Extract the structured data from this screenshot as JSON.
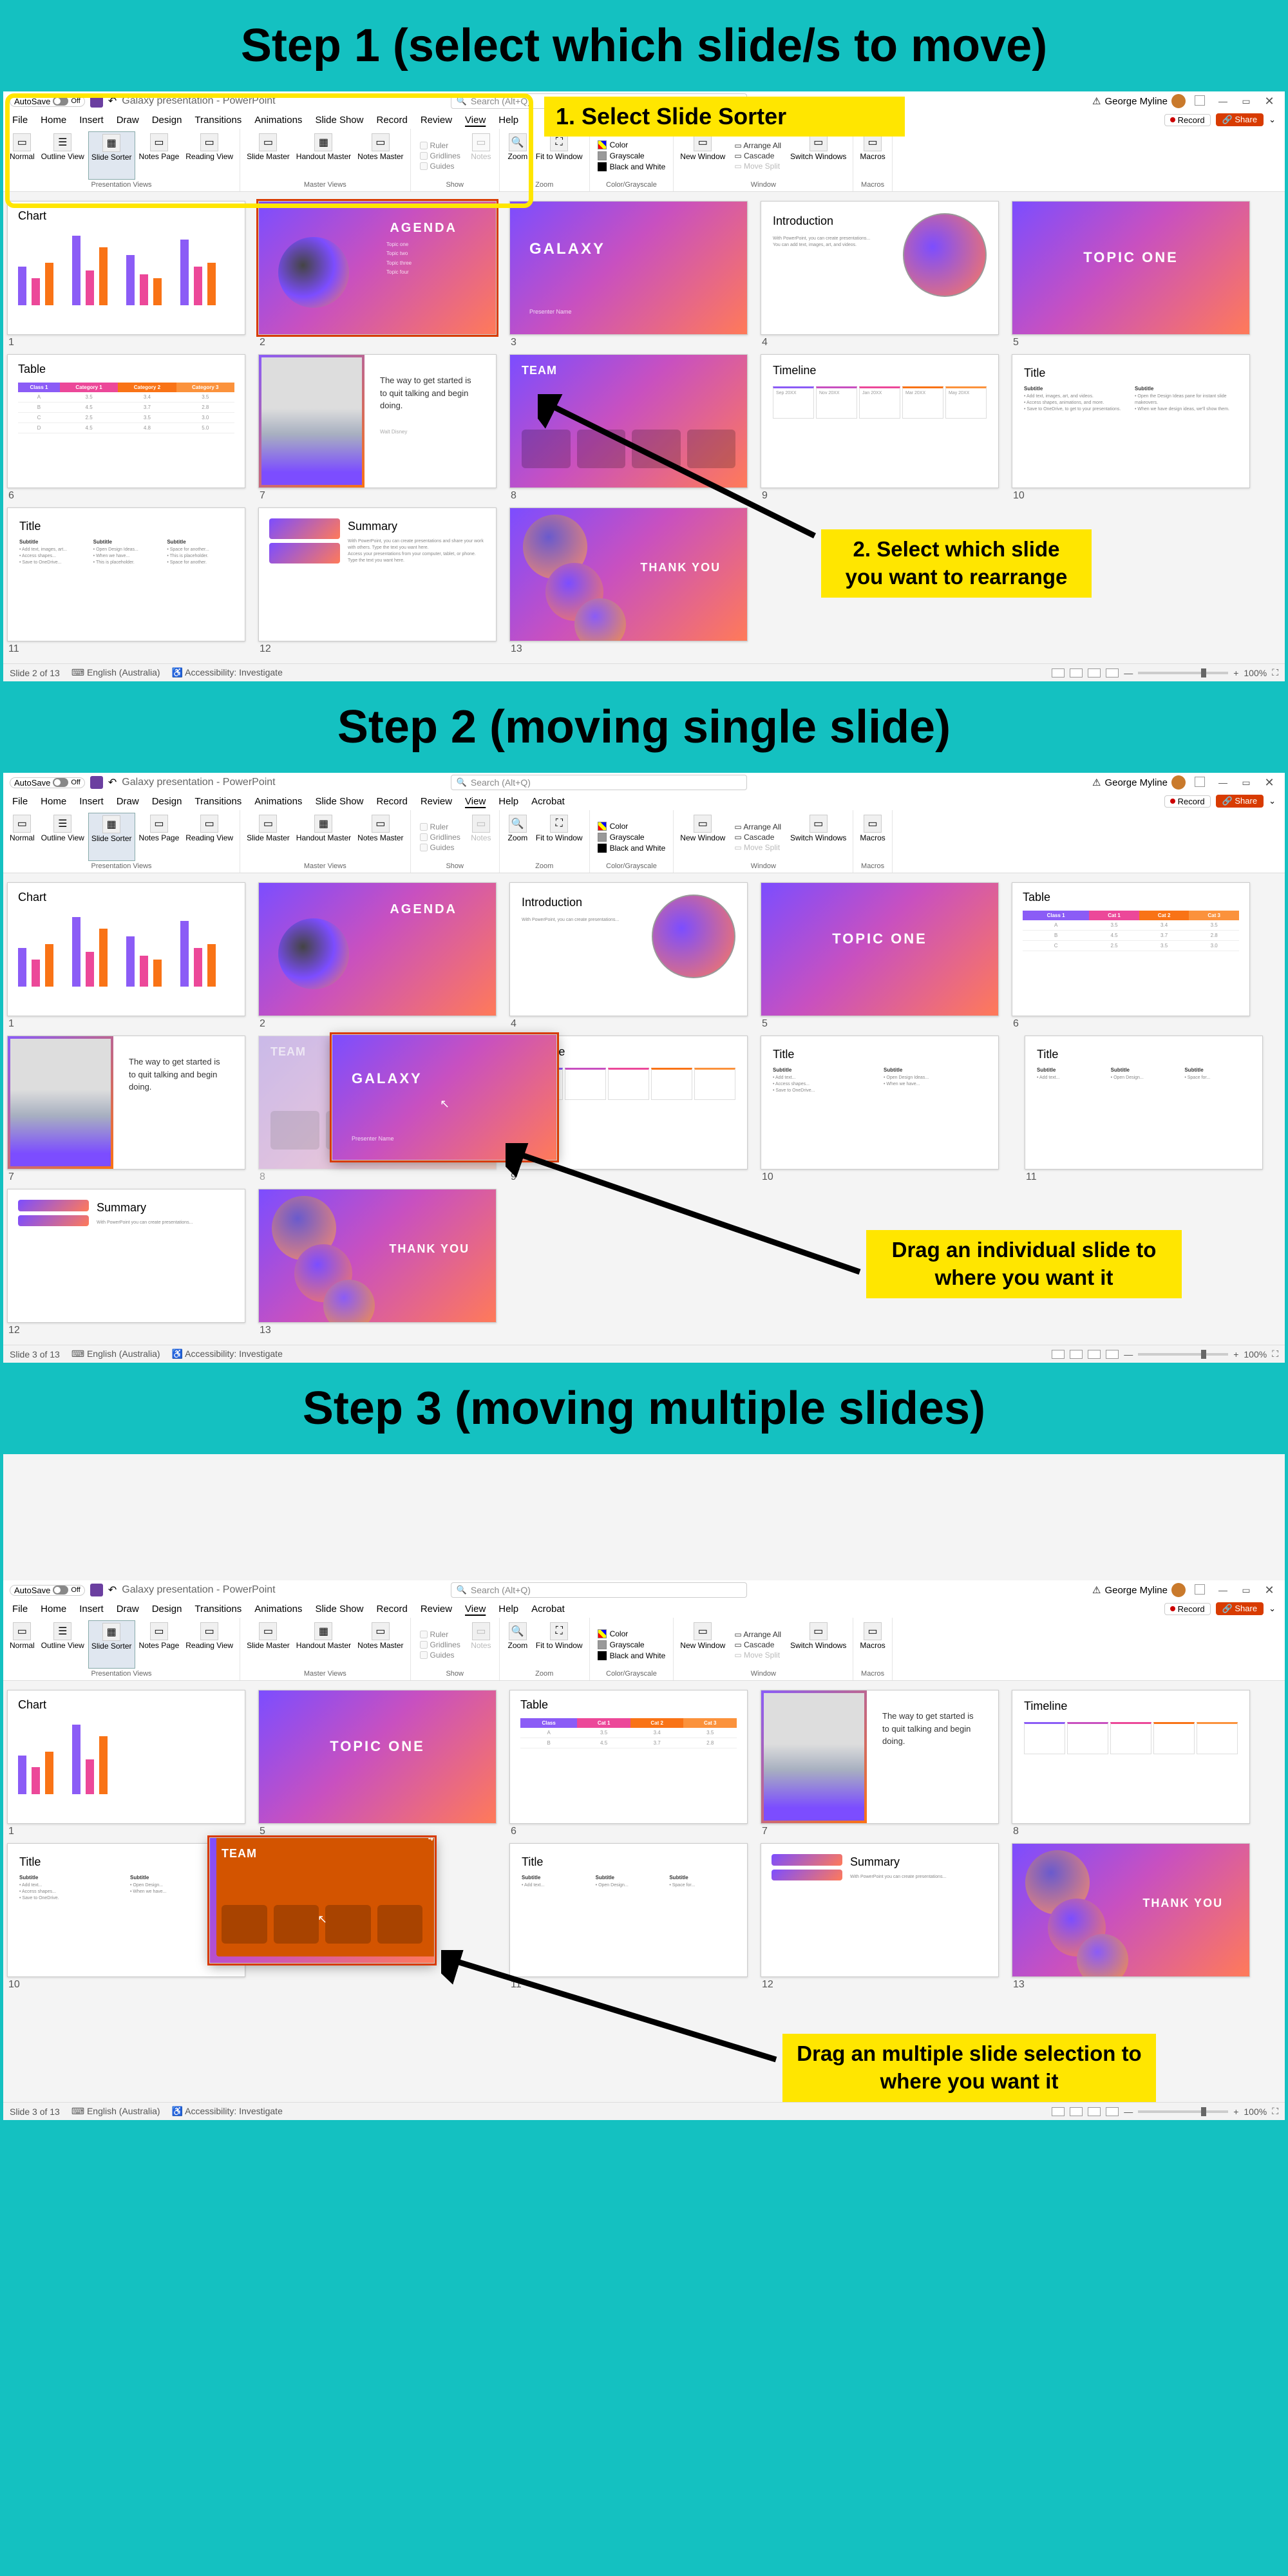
{
  "steps": {
    "s1": "Step 1 (select which slide/s to move)",
    "s2": "Step 2 (moving single slide)",
    "s3": "Step 3 (moving multiple slides)"
  },
  "callouts": {
    "c1": "1.    Select Slide Sorter",
    "c2": "2. Select which slide you want to rearrange",
    "c3": "Drag an individual slide to where you want it",
    "c4": "Drag an multiple slide selection to where you want it"
  },
  "app": {
    "autosave": "AutoSave",
    "title": "Galaxy presentation - PowerPoint",
    "search": "Search (Alt+Q)",
    "user": "George Myline",
    "record": "Record",
    "share": "Share"
  },
  "menu": [
    "File",
    "Home",
    "Insert",
    "Draw",
    "Design",
    "Transitions",
    "Animations",
    "Slide Show",
    "Record",
    "Review",
    "View",
    "Help",
    "Acrobat"
  ],
  "ribbon": {
    "g1": "Presentation Views",
    "g2": "Master Views",
    "g3": "Show",
    "g4": "Zoom",
    "g5": "Color/Grayscale",
    "g6": "Window",
    "g7": "Macros",
    "normal": "Normal",
    "outline": "Outline\nView",
    "sorter": "Slide\nSorter",
    "notesp": "Notes\nPage",
    "reading": "Reading\nView",
    "smaster": "Slide\nMaster",
    "hmaster": "Handout\nMaster",
    "nmaster": "Notes\nMaster",
    "ruler": "Ruler",
    "gridlines": "Gridlines",
    "guides": "Guides",
    "notes": "Notes",
    "zoom": "Zoom",
    "fit": "Fit to\nWindow",
    "color": "Color",
    "gray": "Grayscale",
    "bw": "Black and White",
    "newwin": "New\nWindow",
    "arrange": "Arrange All",
    "cascade": "Cascade",
    "movesplit": "Move Split",
    "switch": "Switch\nWindows",
    "macros": "Macros"
  },
  "slides": {
    "chart": "Chart",
    "agenda": "AGENDA",
    "galaxy": "GALAXY",
    "intro": "Introduction",
    "topic1": "TOPIC ONE",
    "table": "Table",
    "team": "TEAM",
    "timeline": "Timeline",
    "title": "Title",
    "summary": "Summary",
    "thanks": "THANK YOU",
    "way": "The way to get started is to quit talking and begin doing.",
    "subtitle": "Subtitle",
    "presenter": "Presenter Name"
  },
  "status": {
    "s1": "Slide 2 of 13",
    "s2": "Slide 3 of 13",
    "lang": "English (Australia)",
    "acc": "Accessibility: Investigate",
    "zoom": "100%"
  },
  "drag_badge": "4"
}
